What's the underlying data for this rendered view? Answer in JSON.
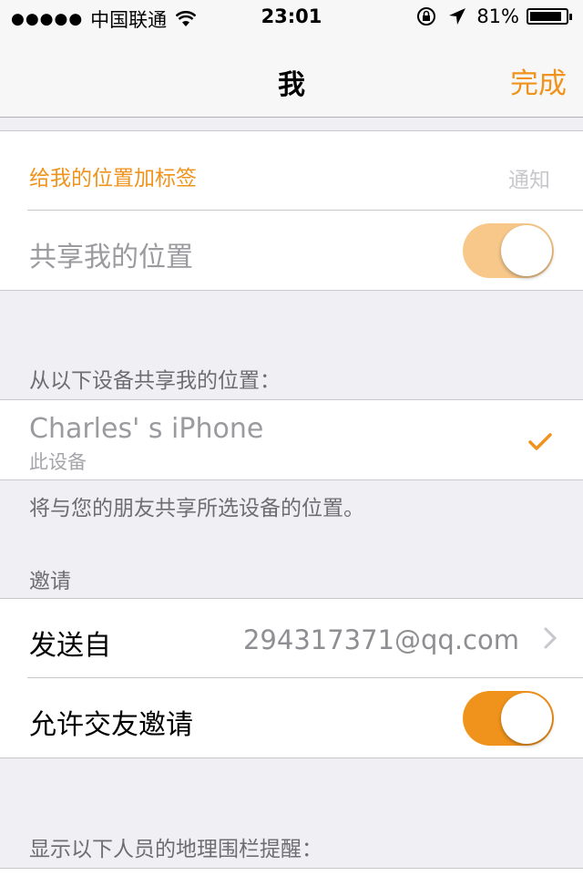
{
  "status_bar": {
    "signal": "●●●●●",
    "carrier": "中国联通",
    "time": "23:01",
    "battery": "81%"
  },
  "nav": {
    "title": "我",
    "done": "完成"
  },
  "section1": {
    "tag_location": "给我的位置加标签",
    "notify": "通知",
    "share_location": "共享我的位置",
    "share_on": true
  },
  "devices": {
    "header": "从以下设备共享我的位置：",
    "device_name": "Charles' s iPhone",
    "device_sub": "此设备",
    "footer": "将与您的朋友共享所选设备的位置。"
  },
  "invite": {
    "header": "邀请",
    "send_from_label": "发送自",
    "send_from_value": "294317371@qq.com",
    "allow_label": "允许交友邀请",
    "allow_on": true
  },
  "geofence": {
    "header": "显示以下人员的地理围栏提醒："
  },
  "colors": {
    "accent": "#f0931c",
    "background": "#efeff4"
  }
}
